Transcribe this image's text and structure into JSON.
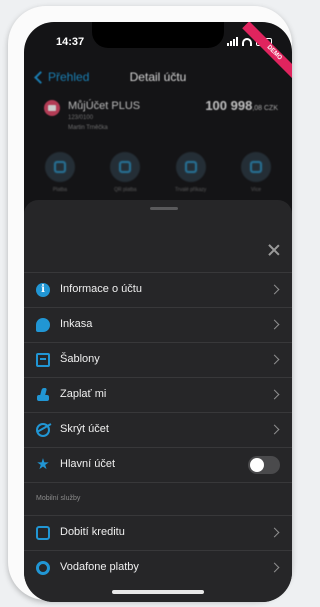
{
  "status_bar": {
    "time": "14:37"
  },
  "nav": {
    "back_label": "Přehled",
    "title": "Detail účtu",
    "badge": "DEMO"
  },
  "account": {
    "name": "MůjÚčet PLUS",
    "number": "123/0100",
    "owner": "Martin Trněčka",
    "balance_main": "100 998",
    "balance_decimal": ",08 CZK"
  },
  "actions": [
    {
      "label": "Platba",
      "icon": "payment-icon"
    },
    {
      "label": "QR platba",
      "icon": "qr-icon"
    },
    {
      "label": "Trvalé příkazy",
      "icon": "repeat-icon"
    },
    {
      "label": "Více",
      "icon": "more-icon"
    }
  ],
  "menu": {
    "items": [
      {
        "label": "Informace o účtu",
        "icon": "info-icon"
      },
      {
        "label": "Inkasa",
        "icon": "inkaso-icon"
      },
      {
        "label": "Šablony",
        "icon": "templates-icon"
      },
      {
        "label": "Zaplať mi",
        "icon": "request-payment-icon"
      },
      {
        "label": "Skrýt účet",
        "icon": "hide-eye-icon"
      },
      {
        "label": "Hlavní účet",
        "icon": "star-icon",
        "toggle": false
      }
    ],
    "section_title": "Mobilní služby",
    "mobile_items": [
      {
        "label": "Dobití kreditu",
        "icon": "phone-icon"
      },
      {
        "label": "Vodafone platby",
        "icon": "vodafone-icon"
      }
    ]
  },
  "colors": {
    "accent": "#2196d4",
    "sheet_bg": "#262628",
    "demo": "#e0245e"
  }
}
